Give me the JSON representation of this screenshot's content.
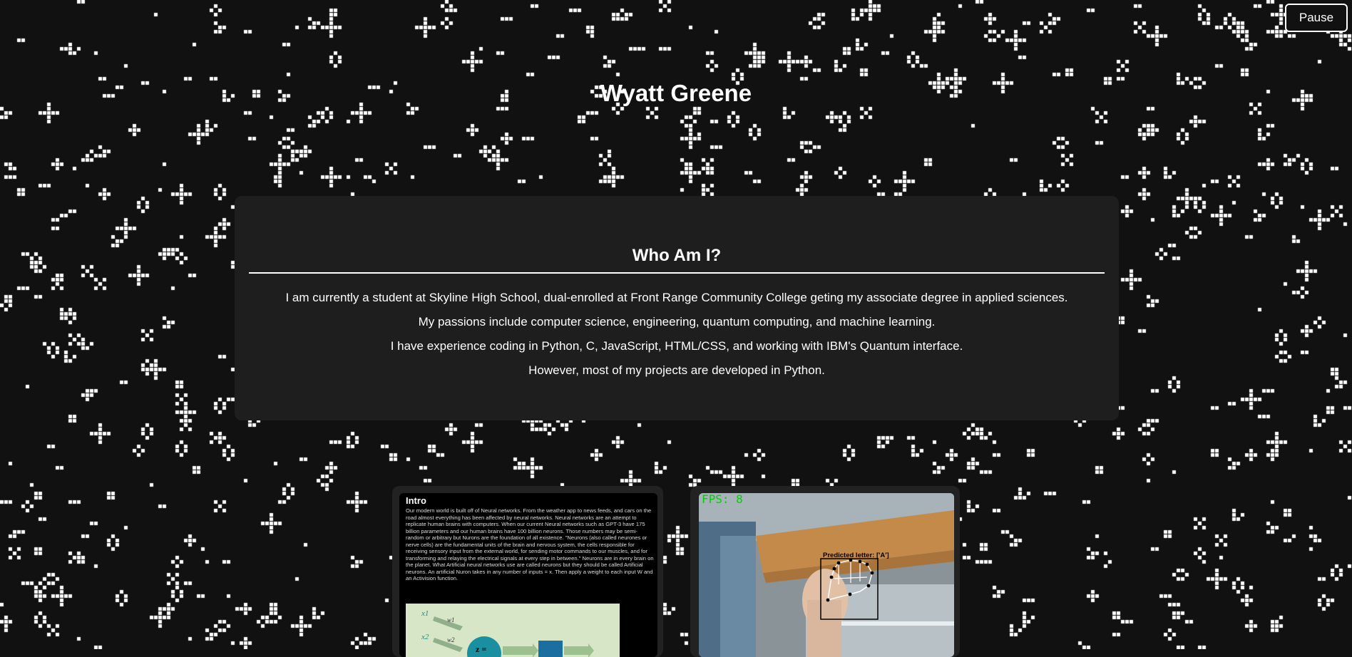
{
  "controls": {
    "pause_label": "Pause"
  },
  "header": {
    "title": "Wyatt Greene"
  },
  "about": {
    "heading": "Who Am I?",
    "lines": [
      "I am currently a student at Skyline High School, dual-enrolled at Front Range Community College geting my associate degree in applied sciences.",
      "My passions include computer science, engineering, quantum computing, and machine learning.",
      "I have experience coding in Python, C, JavaScript, HTML/CSS, and working with IBM's Quantum interface.",
      "However, most of my projects are developed in Python."
    ]
  },
  "projects": {
    "neural": {
      "title": "Intro",
      "body": "Our modern world is built off of Neural networks. From the weather app to news feeds, and cars on the road almost everything has been affected by neural networks. Neural networks are an attempt to replicate human brains with computers. When our current Neural networks such as GPT-3 have 175 billion parameters and our human brains have 100 billion neurons. Those numbers may be semi-random or arbitrary but Nurons are the foundation of all existence. \"Neurons (also called neurones or nerve cells) are the fundamental units of the brain and nervous system, the cells responsible for receiving sensory input from the external world, for sending motor commands to our muscles, and for transforming and relaying the electrical signals at every step in between.\" Neurons are in every brain on the planet. What Artificial neural networks use are called neurons but they should be called Artificial neurons. An artificial Nuron takes in any number of inputs = x. Then apply a weight to each input W and an Activision function.",
      "figure_labels": [
        "x1",
        "x2",
        "w1",
        "w2",
        "z ="
      ]
    },
    "hand": {
      "fps_text": "FPS: 8",
      "prediction_text": "Predicted letter: ['A']"
    }
  },
  "colors": {
    "background": "#111111",
    "card": "#1e1e1e",
    "cell": "#ffffff",
    "fps": "#00d000"
  }
}
